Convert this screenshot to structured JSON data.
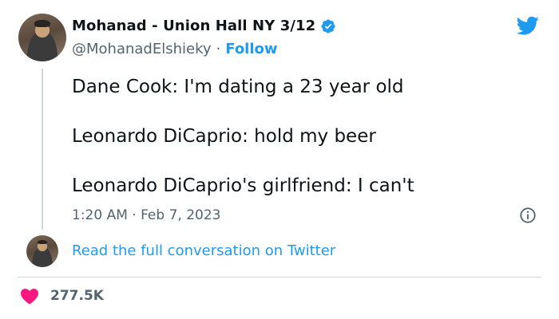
{
  "author": {
    "display_name": "Mohanad - Union Hall NY 3/12",
    "handle": "@MohanadElshieky",
    "separator": "·",
    "follow_label": "Follow",
    "verified": true
  },
  "tweet": {
    "lines": [
      "Dane Cook: I'm dating a 23 year old",
      "Leonardo DiCaprio: hold my beer",
      "Leonardo DiCaprio's girlfriend: I can't"
    ],
    "timestamp": "1:20 AM · Feb 7, 2023"
  },
  "read_more_label": "Read the full conversation on Twitter",
  "likes": {
    "count": "277.5K"
  },
  "icons": {
    "logo": "twitter-bird-icon",
    "verified": "verified-badge-icon",
    "info": "info-icon",
    "like": "heart-icon"
  },
  "colors": {
    "accent": "#1d9bf0",
    "heart": "#f91880",
    "secondary_text": "#536471",
    "primary_text": "#0f1419"
  }
}
